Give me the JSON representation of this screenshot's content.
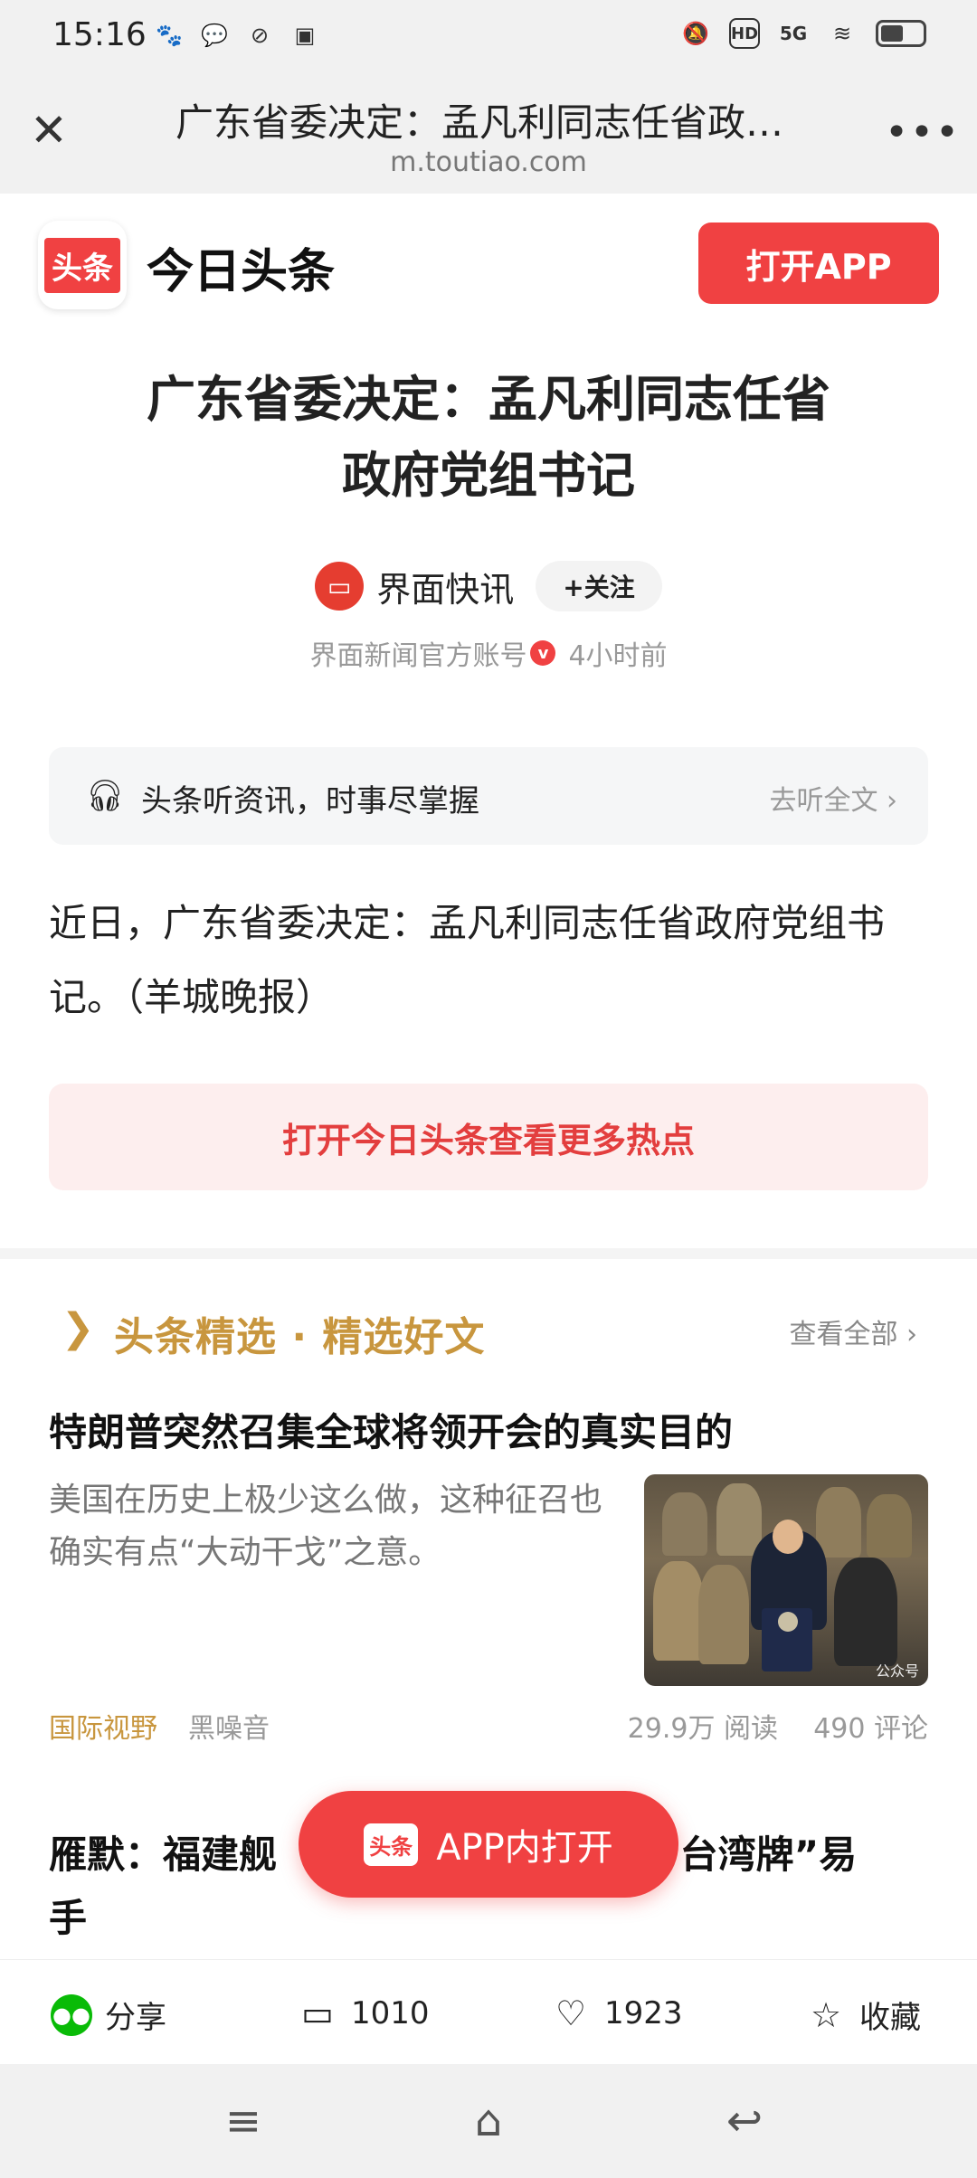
{
  "status_bar": {
    "time": "15:16",
    "left_icons": [
      "baidu-icon",
      "chat-bubble-icon",
      "link-icon",
      "message-box-icon"
    ],
    "network": "5G",
    "hd_label": "HD"
  },
  "browser": {
    "title": "广东省委决定：孟凡利同志任省政…",
    "url": "m.toutiao.com"
  },
  "app_banner": {
    "logo_text": "头条",
    "app_name": "今日头条",
    "open_button": "打开APP"
  },
  "article": {
    "title_line1": "广东省委决定：孟凡利同志任省",
    "title_line2": "政府党组书记",
    "author": "界面快讯",
    "follow_label": "+关注",
    "account_desc": "界面新闻官方账号",
    "verified_mark": "v",
    "time_ago": "4小时前",
    "listen_text": "头条听资讯，时事尽掌握",
    "listen_link": "去听全文 ›",
    "body": "近日，广东省委决定：孟凡利同志任省政府党组书记。（羊城晚报）",
    "hotspot_button": "打开今日头条查看更多热点"
  },
  "featured": {
    "section_title": "头条精选 · 精选好文",
    "see_all": "查看全部 ›",
    "item1": {
      "title": "特朗普突然召集全球将领开会的真实目的",
      "summary": "美国在历史上极少这么做，这种征召也确实有点“大动干戈”之意。",
      "category": "国际视野",
      "source": "黑噪音",
      "reads": "29.9万 阅读",
      "comments": "490 评论",
      "image_watermark": "公众号"
    },
    "item2": {
      "title_left": "雁默：福建舰",
      "title_right": "“台湾牌”易",
      "title_line2": "手"
    }
  },
  "float_button": {
    "logo_text": "头条",
    "label": "APP内打开"
  },
  "actions": {
    "share": "分享",
    "comments": "1010",
    "likes": "1923",
    "favorite": "收藏"
  }
}
